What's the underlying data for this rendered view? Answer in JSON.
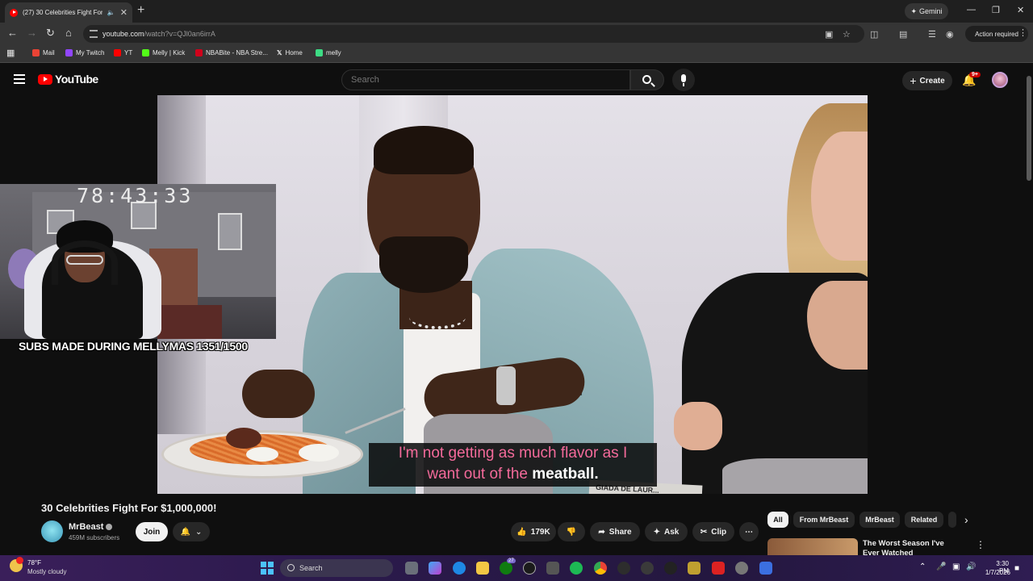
{
  "browser": {
    "tab_title": "(27) 30 Celebrities Fight For",
    "new_tab": "+",
    "gemini_label": "Gemini",
    "url_host": "youtube.com",
    "url_path": "/watch?v=QJl0an6irrA",
    "action_required": "Action required",
    "bookmarks": [
      {
        "label": "Mail",
        "color": "#ea4335"
      },
      {
        "label": "My Twitch",
        "color": "#9146ff"
      },
      {
        "label": "YT",
        "color": "#ff0000"
      },
      {
        "label": "Melly | Kick",
        "color": "#53fc18"
      },
      {
        "label": "NBABite - NBA Stre...",
        "color": "#d0021b"
      },
      {
        "label": "Home",
        "color": "#ffffff"
      },
      {
        "label": "melly",
        "color": "#3ddc84"
      }
    ]
  },
  "youtube": {
    "logo_text": "YouTube",
    "search_placeholder": "Search",
    "create_label": "Create",
    "notifications_badge": "9+"
  },
  "video": {
    "caption_pink": "I'm not getting as much flavor as I",
    "caption_line2_pink": "want out of the",
    "caption_white": "meatball.",
    "nameplate": "GIADA DE LAUR...",
    "title": "30 Celebrities Fight For $1,000,000!",
    "channel_name": "MrBeast",
    "channel_subs": "459M subscribers",
    "join_label": "Join",
    "likes": "179K",
    "share_label": "Share",
    "ask_label": "Ask",
    "clip_label": "Clip",
    "more_label": "⋯"
  },
  "stream_overlay": {
    "timer": "78:43:33",
    "subs_goal": "SUBS MADE DURING MELLYMAS 1351/1500"
  },
  "recommendations": {
    "chips": [
      "All",
      "From MrBeast",
      "MrBeast",
      "Related"
    ],
    "first_title": "The Worst Season I've Ever Watched"
  },
  "taskbar": {
    "weather_temp": "78°F",
    "weather_desc": "Mostly cloudy",
    "search_placeholder": "Search",
    "app_badge": "27",
    "time": "3:30 PM",
    "date": "1/7/2026"
  }
}
